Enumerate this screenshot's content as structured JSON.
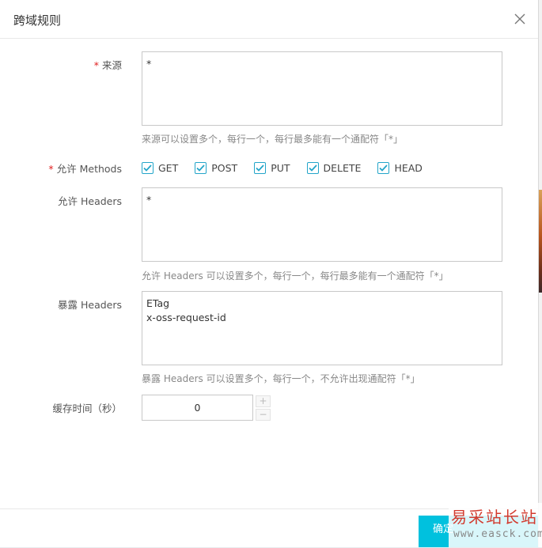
{
  "dialog": {
    "title": "跨域规则"
  },
  "form": {
    "origin": {
      "label": "来源",
      "required_mark": "*",
      "value": "*",
      "help": "来源可以设置多个，每行一个，每行最多能有一个通配符「*」"
    },
    "methods": {
      "label": "允许 Methods",
      "required_mark": "*",
      "options": [
        {
          "label": "GET",
          "checked": true
        },
        {
          "label": "POST",
          "checked": true
        },
        {
          "label": "PUT",
          "checked": true
        },
        {
          "label": "DELETE",
          "checked": true
        },
        {
          "label": "HEAD",
          "checked": true
        }
      ]
    },
    "allow_headers": {
      "label": "允许 Headers",
      "value": "*",
      "help": "允许 Headers 可以设置多个，每行一个，每行最多能有一个通配符「*」"
    },
    "expose_headers": {
      "label": "暴露 Headers",
      "value": "ETag\nx-oss-request-id",
      "help": "暴露 Headers 可以设置多个，每行一个，不允许出现通配符「*」"
    },
    "cache_time": {
      "label": "缓存时间（秒）",
      "value": "0",
      "increment_label": "+",
      "decrement_label": "−"
    }
  },
  "footer": {
    "confirm_label": "确定"
  },
  "watermark": {
    "main": "易采站长站",
    "url": "www.easck.com"
  },
  "colors": {
    "accent": "#00c1de",
    "checkbox": "#23a5c9",
    "required": "#e02020"
  },
  "icons": {
    "close": "close-icon",
    "check": "check-icon"
  }
}
